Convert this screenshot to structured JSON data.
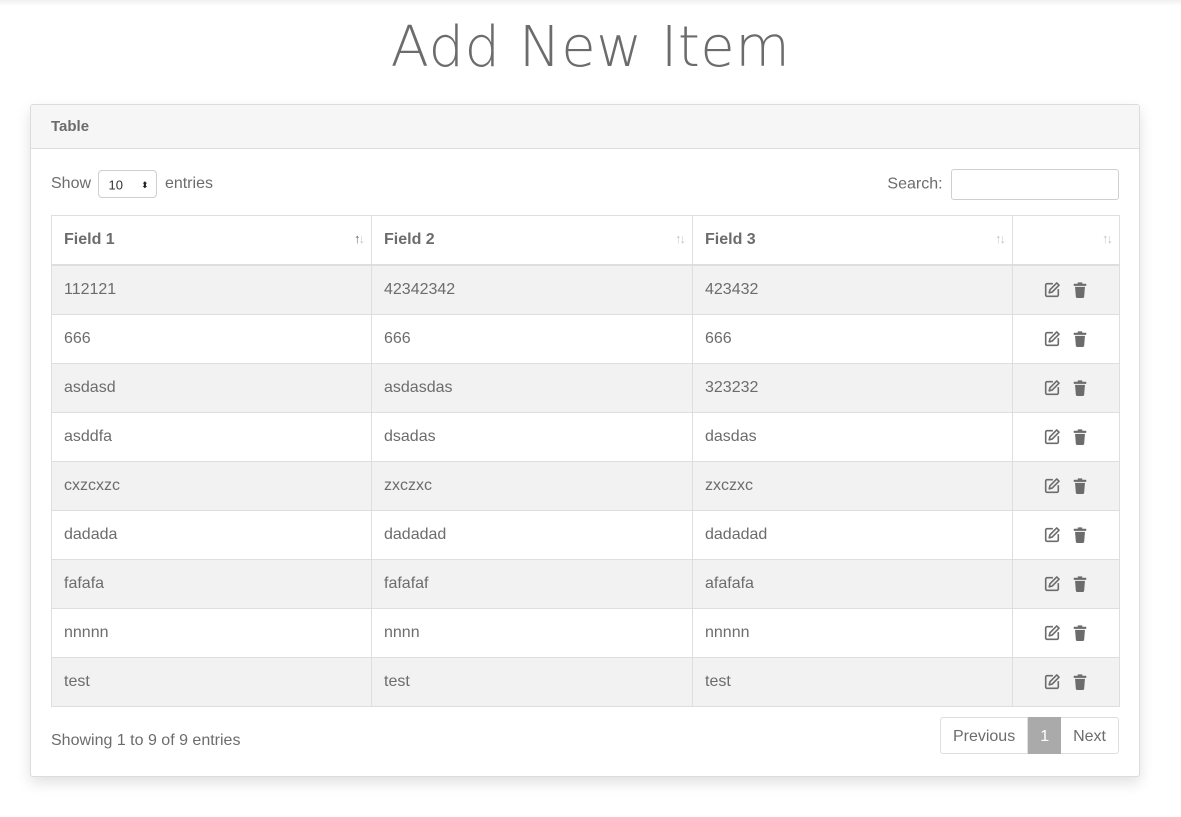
{
  "page": {
    "title": "Add New Item"
  },
  "card": {
    "header": "Table"
  },
  "length": {
    "show_label": "Show",
    "selected": "10",
    "entries_label": "entries"
  },
  "search": {
    "label": "Search:",
    "value": "",
    "placeholder": ""
  },
  "table": {
    "columns": [
      "Field 1",
      "Field 2",
      "Field 3",
      ""
    ],
    "rows": [
      [
        "112121",
        "42342342",
        "423432"
      ],
      [
        "666",
        "666",
        "666"
      ],
      [
        "asdasd",
        "asdasdas",
        "323232"
      ],
      [
        "asddfa",
        "dsadas",
        "dasdas"
      ],
      [
        "cxzcxzc",
        "zxczxc",
        "zxczxc"
      ],
      [
        "dadada",
        "dadadad",
        "dadadad"
      ],
      [
        "fafafa",
        "fafafaf",
        "afafafa"
      ],
      [
        "nnnnn",
        "nnnn",
        "nnnnn"
      ],
      [
        "test",
        "test",
        "test"
      ]
    ],
    "row_actions": [
      "edit-icon",
      "trash-icon"
    ]
  },
  "footer": {
    "info": "Showing 1 to 9 of 9 entries"
  },
  "pagination": {
    "previous": "Previous",
    "current": "1",
    "next": "Next"
  },
  "colors": {
    "text": "#6c6c6c",
    "stripe": "#f2f2f2",
    "active_page": "#aaaaaa"
  }
}
